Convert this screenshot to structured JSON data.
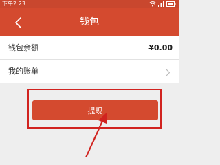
{
  "status_bar": {
    "time": "下午2:23",
    "icons": [
      "wifi-icon",
      "signal-icon",
      "battery-icon"
    ]
  },
  "nav": {
    "title": "钱包",
    "back_icon": "chevron-left-icon"
  },
  "wallet": {
    "balance_label": "钱包余额",
    "balance_value": "¥0.00",
    "bill_label": "我的账单",
    "bill_icon": "chevron-right-icon"
  },
  "withdraw_button": {
    "label": "提现"
  },
  "colors": {
    "header": "#d44a2f",
    "button": "#d44a2f",
    "annotation": "#d1231f",
    "background": "#eeeeee"
  }
}
